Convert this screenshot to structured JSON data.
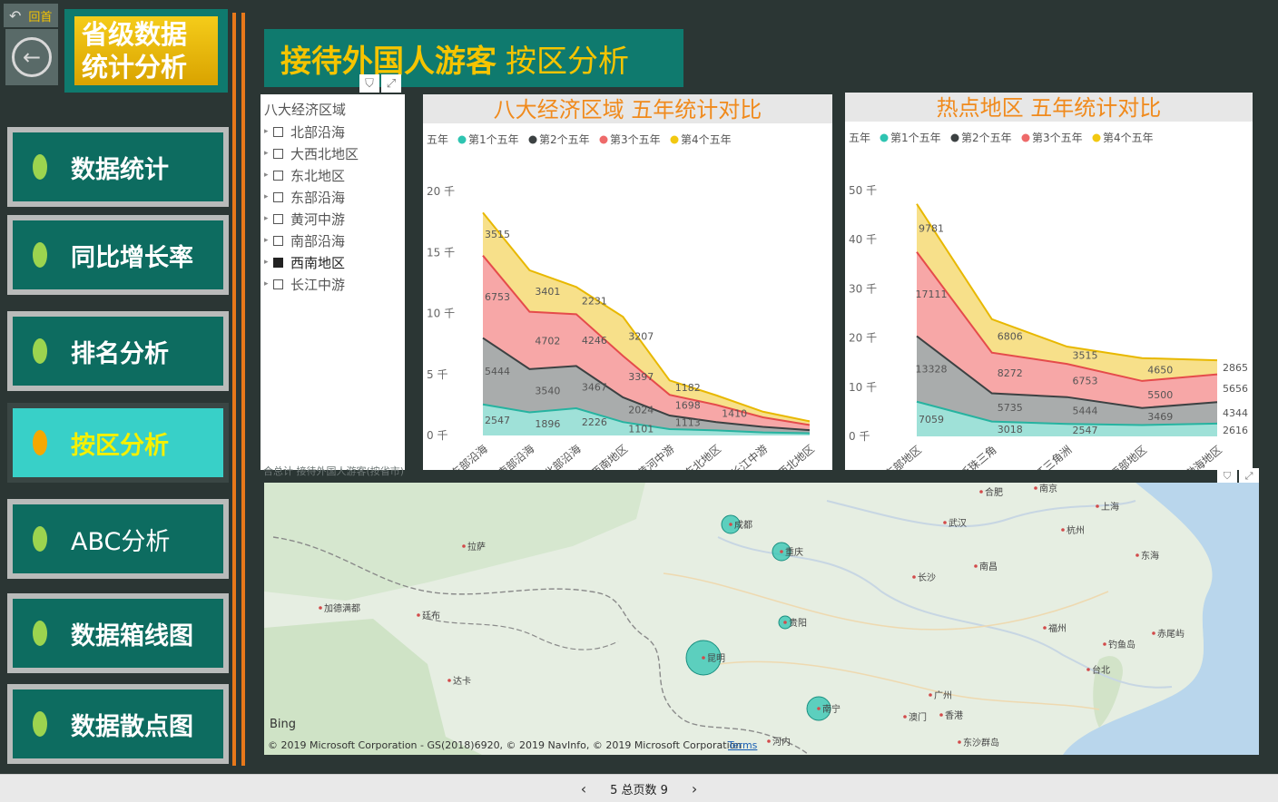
{
  "nav": {
    "back_label": "回首",
    "province_title": "省级数据统计分析",
    "items": [
      {
        "label": "数据统计"
      },
      {
        "label": "同比增长率"
      },
      {
        "label": "排名分析"
      },
      {
        "label": "按区分析"
      },
      {
        "label": "ABC分析"
      },
      {
        "label": "数据箱线图"
      },
      {
        "label": "数据散点图"
      }
    ]
  },
  "header": {
    "title_bold": "接待外国人游客",
    "title_rest": "按区分析"
  },
  "slicer": {
    "title": "八大经济区域",
    "items": [
      "北部沿海",
      "大西北地区",
      "东北地区",
      "东部沿海",
      "黄河中游",
      "南部沿海",
      "西南地区",
      "长江中游"
    ],
    "selected": "西南地区"
  },
  "colors": {
    "series1": "#2ec4b1",
    "series2": "#3c4142",
    "series3": "#ee6a6a",
    "series4": "#f2c811",
    "accent": "#f08a1c",
    "teal": "#0f7a6e"
  },
  "chart_data": [
    {
      "type": "area",
      "title": "八大经济区域 五年统计对比",
      "legend_title": "五年",
      "categories": [
        "东部沿海",
        "南部沿海",
        "北部沿海",
        "西南地区",
        "黄河中游",
        "东北地区",
        "长江中游",
        "大西北地区"
      ],
      "series": [
        {
          "name": "第1个五年",
          "values": [
            2547,
            1896,
            2226,
            1101,
            520,
            420,
            250,
            180
          ]
        },
        {
          "name": "第2个五年",
          "values": [
            5444,
            3540,
            3467,
            2024,
            1113,
            680,
            460,
            260
          ]
        },
        {
          "name": "第3个五年",
          "values": [
            6753,
            4702,
            4246,
            3397,
            1698,
            1410,
            780,
            420
          ]
        },
        {
          "name": "第4个五年",
          "values": [
            3515,
            3401,
            2231,
            3207,
            1182,
            780,
            460,
            300
          ]
        }
      ],
      "data_labels": [
        {
          "cat": 0,
          "series": 0,
          "text": "2547"
        },
        {
          "cat": 1,
          "series": 0,
          "text": "1896"
        },
        {
          "cat": 2,
          "series": 0,
          "text": "2226"
        },
        {
          "cat": 3,
          "series": 0,
          "text": "1101"
        },
        {
          "cat": 0,
          "series": 1,
          "text": "5444"
        },
        {
          "cat": 1,
          "series": 1,
          "text": "3540"
        },
        {
          "cat": 2,
          "series": 1,
          "text": "3467"
        },
        {
          "cat": 3,
          "series": 1,
          "text": "2024"
        },
        {
          "cat": 4,
          "series": 1,
          "text": "1113"
        },
        {
          "cat": 0,
          "series": 2,
          "text": "6753"
        },
        {
          "cat": 1,
          "series": 2,
          "text": "4702"
        },
        {
          "cat": 2,
          "series": 2,
          "text": "4246"
        },
        {
          "cat": 3,
          "series": 2,
          "text": "3397"
        },
        {
          "cat": 4,
          "series": 2,
          "text": "1698"
        },
        {
          "cat": 5,
          "series": 2,
          "text": "1410"
        },
        {
          "cat": 0,
          "series": 3,
          "text": "3515"
        },
        {
          "cat": 1,
          "series": 3,
          "text": "3401"
        },
        {
          "cat": 2,
          "series": 3,
          "text": "2231"
        },
        {
          "cat": 3,
          "series": 3,
          "text": "3207"
        },
        {
          "cat": 4,
          "series": 3,
          "text": "1182"
        }
      ],
      "ylim": [
        0,
        20000
      ],
      "yticks": [
        "0 千",
        "5 千",
        "10 千",
        "15 千",
        "20 千"
      ],
      "ytick_values": [
        0,
        5000,
        10000,
        15000,
        20000
      ]
    },
    {
      "type": "area",
      "title": "热点地区 五年统计对比",
      "legend_title": "五年",
      "categories": [
        "东部地区",
        "泛珠三角",
        "长江三角洲",
        "西部地区",
        "环渤海地区"
      ],
      "series": [
        {
          "name": "第1个五年",
          "values": [
            7059,
            3018,
            2547,
            2300,
            2616
          ]
        },
        {
          "name": "第2个五年",
          "values": [
            13328,
            5735,
            5444,
            3469,
            4344
          ]
        },
        {
          "name": "第3个五年",
          "values": [
            17111,
            8272,
            6753,
            5500,
            5656
          ]
        },
        {
          "name": "第4个五年",
          "values": [
            9781,
            6806,
            3515,
            4650,
            2865
          ]
        }
      ],
      "data_labels": [
        {
          "cat": 0,
          "series": 0,
          "text": "7059"
        },
        {
          "cat": 1,
          "series": 0,
          "text": "3018"
        },
        {
          "cat": 2,
          "series": 0,
          "text": "2547"
        },
        {
          "cat": 4,
          "series": 0,
          "text": "2616"
        },
        {
          "cat": 0,
          "series": 1,
          "text": "13328"
        },
        {
          "cat": 1,
          "series": 1,
          "text": "5735"
        },
        {
          "cat": 2,
          "series": 1,
          "text": "5444"
        },
        {
          "cat": 3,
          "series": 1,
          "text": "3469"
        },
        {
          "cat": 4,
          "series": 1,
          "text": "4344"
        },
        {
          "cat": 0,
          "series": 2,
          "text": "17111"
        },
        {
          "cat": 1,
          "series": 2,
          "text": "8272"
        },
        {
          "cat": 2,
          "series": 2,
          "text": "6753"
        },
        {
          "cat": 3,
          "series": 2,
          "text": "5500"
        },
        {
          "cat": 4,
          "series": 2,
          "text": "5656"
        },
        {
          "cat": 0,
          "series": 3,
          "text": "9781"
        },
        {
          "cat": 1,
          "series": 3,
          "text": "6806"
        },
        {
          "cat": 2,
          "series": 3,
          "text": "3515"
        },
        {
          "cat": 3,
          "series": 3,
          "text": "4650"
        },
        {
          "cat": 4,
          "series": 3,
          "text": "2865"
        }
      ],
      "ylim": [
        0,
        50000
      ],
      "yticks": [
        "0 千",
        "10 千",
        "20 千",
        "30 千",
        "40 千",
        "50 千"
      ],
      "ytick_values": [
        0,
        10000,
        20000,
        30000,
        40000,
        50000
      ]
    }
  ],
  "map": {
    "caption": "合总计 接待外国人游客(按省市)",
    "cities": [
      "成都",
      "重庆",
      "贵阳",
      "昆明",
      "南宁",
      "拉萨",
      "加德满都",
      "廷布",
      "达卡",
      "合肥",
      "南京",
      "上海",
      "武汉",
      "杭州",
      "长沙",
      "南昌",
      "福州",
      "广州",
      "澳门",
      "香港",
      "台北",
      "河内",
      "东海",
      "钓鱼岛",
      "赤尾屿",
      "东沙群岛"
    ],
    "bubbles": [
      {
        "city": "成都",
        "value": 2
      },
      {
        "city": "重庆",
        "value": 2
      },
      {
        "city": "贵阳",
        "value": 1
      },
      {
        "city": "昆明",
        "value": 5
      },
      {
        "city": "南宁",
        "value": 3
      }
    ],
    "bing": "Bing",
    "copyright": "© 2019 Microsoft Corporation - GS(2018)6920, © 2019 NavInfo, © 2019 Microsoft Corporation",
    "terms": "Terms"
  },
  "footer": {
    "page_label": "5 总页数 9"
  }
}
